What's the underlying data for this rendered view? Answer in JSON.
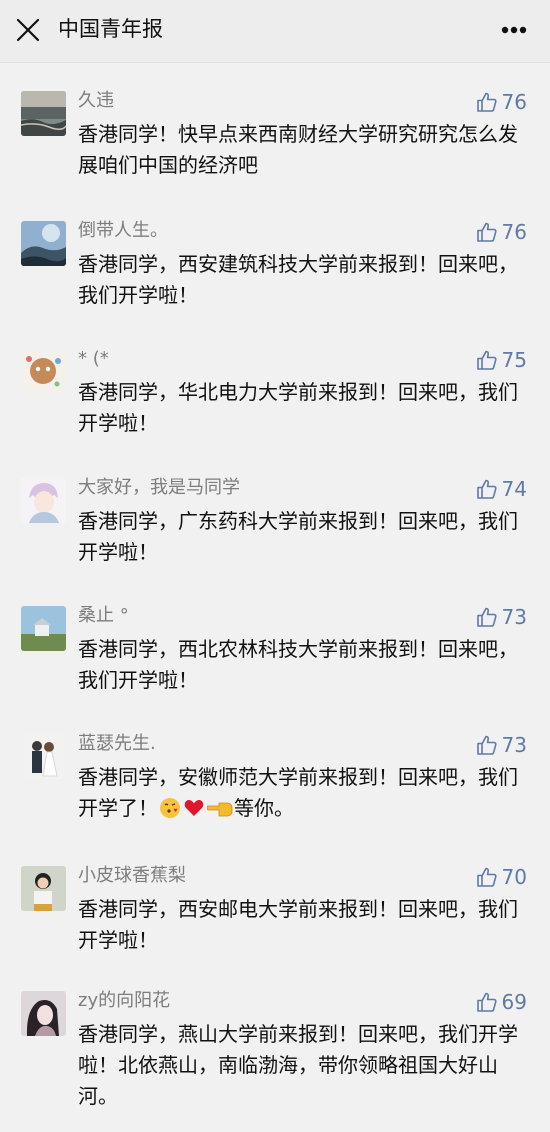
{
  "header": {
    "title": "中国青年报"
  },
  "comments": [
    {
      "nickname": "久违",
      "likes": "76",
      "text": "香港同学！快早点来西南财经大学研究研究怎么发展咱们中国的经济吧"
    },
    {
      "nickname": "倒带人生。",
      "likes": "76",
      "text": "香港同学，西安建筑科技大学前来报到！回来吧，我们开学啦！"
    },
    {
      "nickname": "* (*",
      "likes": "75",
      "text": "香港同学，华北电力大学前来报到！回来吧，我们开学啦！"
    },
    {
      "nickname": "大家好，我是马同学",
      "likes": "74",
      "text": "香港同学，广东药科大学前来报到！回来吧，我们开学啦！"
    },
    {
      "nickname": "桑止 °",
      "likes": "73",
      "text": "香港同学，西北农林科技大学前来报到！回来吧，我们开学啦！"
    },
    {
      "nickname": "蓝瑟先生.",
      "likes": "73",
      "text": "香港同学，安徽师范大学前来报到！回来吧，我们开学了！",
      "text_after": "等你。",
      "emojis": [
        "face-blowing-kiss",
        "red-heart",
        "backhand-index-pointing-left"
      ]
    },
    {
      "nickname": "小皮球香蕉梨",
      "likes": "70",
      "text": "香港同学，西安邮电大学前来报到！回来吧，我们开学啦！"
    },
    {
      "nickname": "zy的向阳花",
      "likes": "69",
      "text": "香港同学，燕山大学前来报到！回来吧，我们开学啦！北依燕山，南临渤海，带你领略祖国大好山河。"
    }
  ],
  "colors": {
    "background": "#f1f1f1",
    "nickname": "#7d7d7d",
    "like_count": "#5f79a8",
    "content_text": "#111111"
  },
  "icons": {
    "close": "close-icon",
    "more": "more-dots-icon",
    "like": "thumbs-up-icon"
  }
}
